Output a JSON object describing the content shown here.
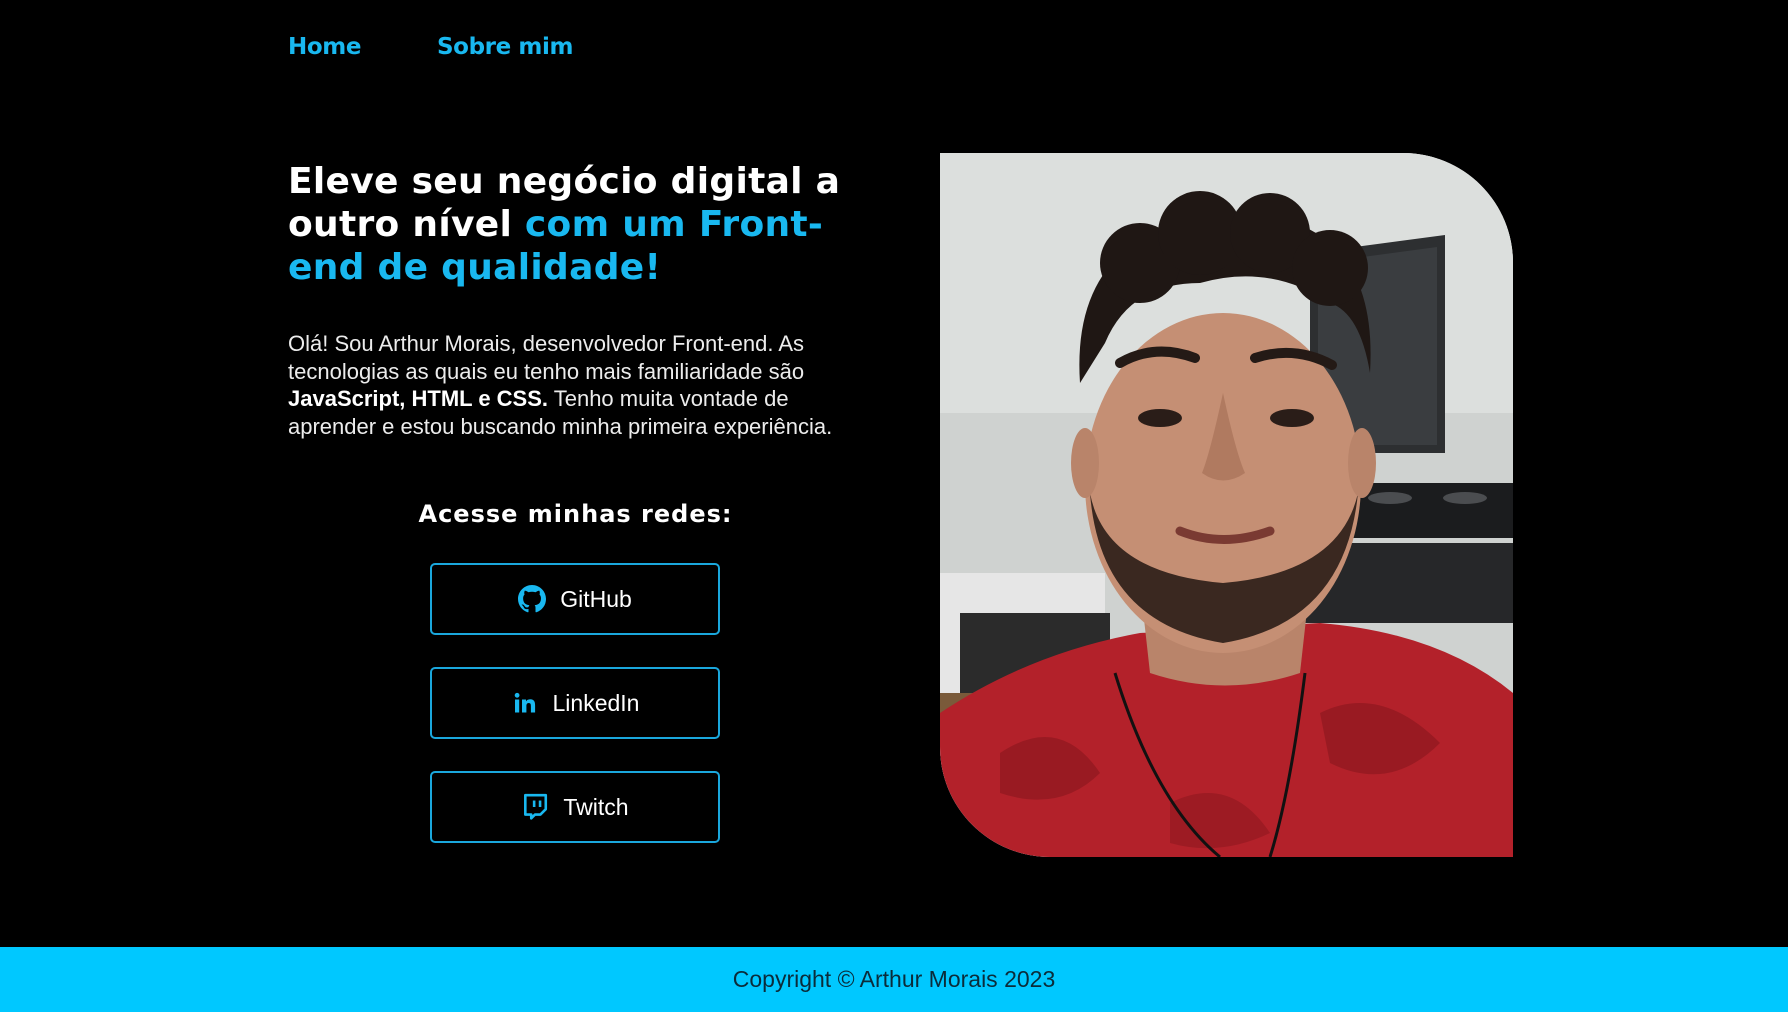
{
  "nav": {
    "home": "Home",
    "about": "Sobre mim"
  },
  "hero": {
    "title_part1": "Eleve seu negócio digital a outro nível ",
    "title_accent": "com um Front-end de qualidade!",
    "intro_part1": "Olá! Sou Arthur Morais, desenvolvedor Front-end. As tecnologias as quais eu tenho mais familiaridade são ",
    "intro_bold": "JavaScript, HTML e CSS.",
    "intro_part2": " Tenho muita vontade de aprender e estou buscando minha primeira experiência."
  },
  "social": {
    "title": "Acesse minhas redes:",
    "links": [
      {
        "label": "GitHub",
        "icon": "github-icon"
      },
      {
        "label": "LinkedIn",
        "icon": "linkedin-icon"
      },
      {
        "label": "Twitch",
        "icon": "twitch-icon"
      }
    ]
  },
  "photo": {
    "description_icon": "profile-photo"
  },
  "footer": {
    "copyright": "Copyright © Arthur Morais 2023"
  },
  "colors": {
    "accent": "#19b8f0",
    "footer_bg": "#00c8ff",
    "background": "#000000",
    "button_border": "#1aa7dc"
  }
}
